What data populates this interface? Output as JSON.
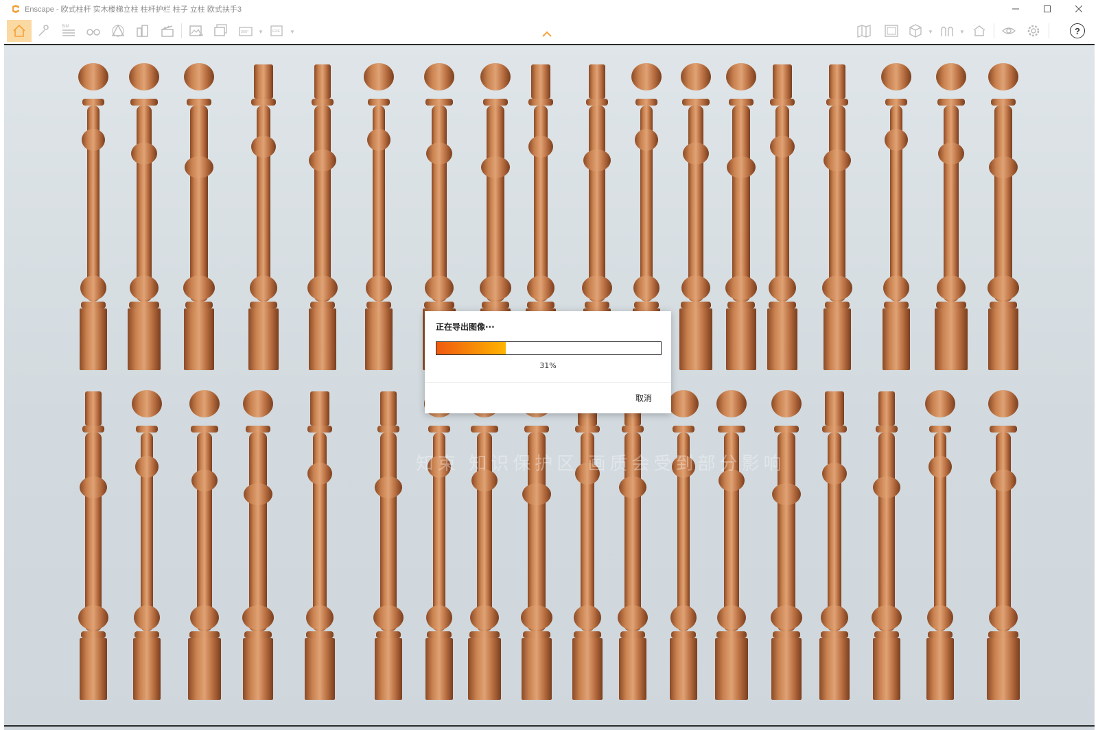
{
  "window": {
    "title": "Enscape - 欧式柱杆 实木楼梯立柱 柱杆护栏 柱子 立柱 欧式扶手3",
    "minimize_icon": "minimize-icon",
    "maximize_icon": "maximize-icon",
    "close_icon": "close-icon"
  },
  "toolbar": {
    "home_icon": "home-icon",
    "bim_label": "BIM",
    "pano_label": "360°",
    "exe_label": "EXE",
    "help_label": "?",
    "accent_color": "#f3a23a"
  },
  "viewport": {
    "watermark": "知束  知识保护区  画质会受到部分影响"
  },
  "dialog": {
    "title": "正在导出图像···",
    "progress": 0.31,
    "progress_text": "31%",
    "cancel_label": "取消"
  }
}
